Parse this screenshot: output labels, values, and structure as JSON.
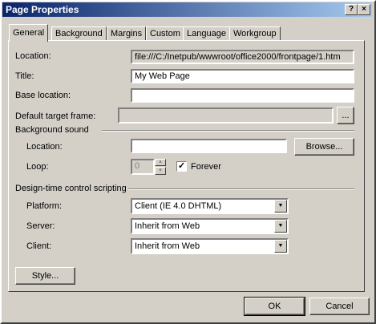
{
  "window": {
    "title": "Page Properties",
    "help_button": "?",
    "close_button": "×"
  },
  "tabs": [
    {
      "label": "General"
    },
    {
      "label": "Background"
    },
    {
      "label": "Margins"
    },
    {
      "label": "Custom"
    },
    {
      "label": "Language"
    },
    {
      "label": "Workgroup"
    }
  ],
  "general": {
    "location_label": "Location:",
    "location_value": "file:///C:/Inetpub/wwwroot/office2000/frontpage/1.htm",
    "title_label": "Title:",
    "title_value": "My Web Page",
    "base_location_label": "Base location:",
    "base_location_value": "",
    "target_frame_label": "Default target frame:",
    "target_frame_value": "",
    "target_frame_button": "..."
  },
  "background_sound": {
    "group_label": "Background sound",
    "location_label": "Location:",
    "location_value": "",
    "browse_button": "Browse...",
    "loop_label": "Loop:",
    "loop_value": "0",
    "forever_label": "Forever",
    "forever_checked": true
  },
  "scripting": {
    "group_label": "Design-time control scripting",
    "platform_label": "Platform:",
    "platform_value": "Client (IE 4.0 DHTML)",
    "server_label": "Server:",
    "server_value": "Inherit from Web",
    "client_label": "Client:",
    "client_value": "Inherit from Web"
  },
  "buttons": {
    "style": "Style...",
    "ok": "OK",
    "cancel": "Cancel"
  }
}
